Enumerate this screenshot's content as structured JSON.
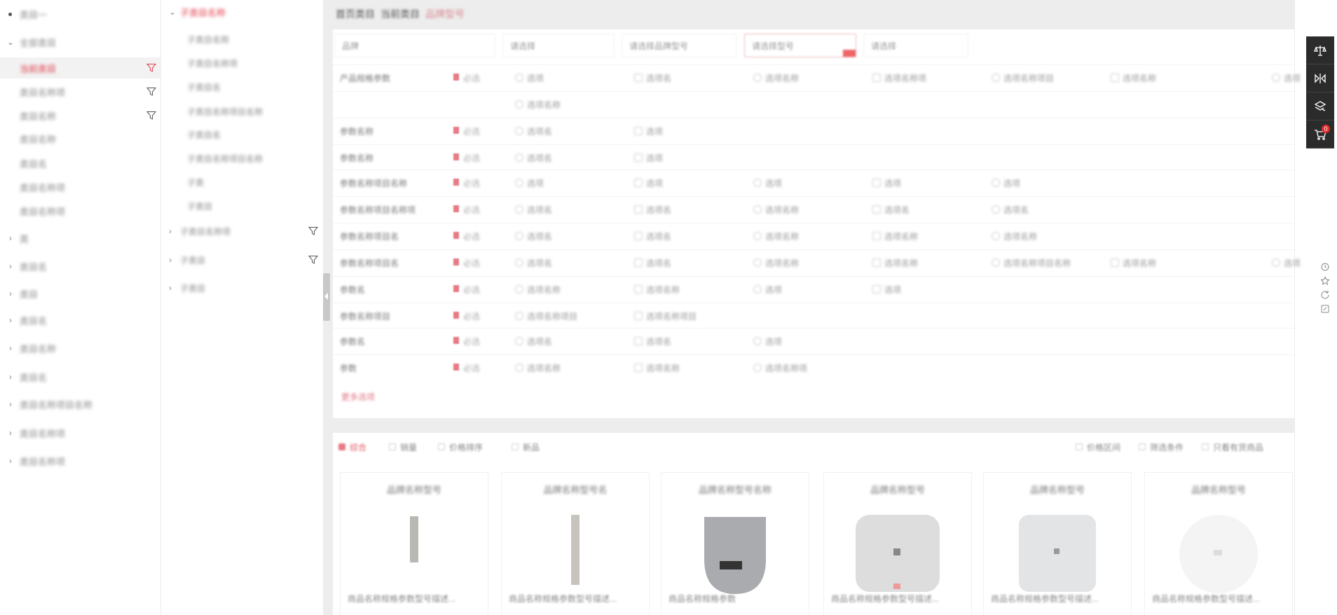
{
  "level1": [
    {
      "label": "类目一",
      "arrow": "dot",
      "filter": false,
      "active": false
    },
    {
      "label": "全部类目",
      "arrow": "down",
      "filter": false,
      "active": false
    },
    {
      "label": "当前类目",
      "arrow": "",
      "filter": true,
      "active": true
    },
    {
      "label": "类目名称项",
      "arrow": "",
      "filter": true,
      "active": false
    },
    {
      "label": "类目名称",
      "arrow": "",
      "filter": true,
      "active": false
    },
    {
      "label": "类目名称",
      "arrow": "",
      "filter": false,
      "active": false
    },
    {
      "label": "类目名",
      "arrow": "",
      "filter": false,
      "active": false
    },
    {
      "label": "类目名称项",
      "arrow": "",
      "filter": false,
      "active": false
    },
    {
      "label": "类目名称项",
      "arrow": "",
      "filter": false,
      "active": false
    },
    {
      "label": "类",
      "arrow": "right",
      "filter": false,
      "active": false
    },
    {
      "label": "类目名",
      "arrow": "right",
      "filter": false,
      "active": false
    },
    {
      "label": "类目",
      "arrow": "right",
      "filter": false,
      "active": false
    },
    {
      "label": "类目名",
      "arrow": "right",
      "filter": false,
      "active": false
    },
    {
      "label": "类目名称",
      "arrow": "right",
      "filter": false,
      "active": false
    },
    {
      "label": "类目名",
      "arrow": "right",
      "filter": false,
      "active": false
    },
    {
      "label": "类目名称项目名称",
      "arrow": "right",
      "filter": false,
      "active": false
    },
    {
      "label": "类目名称项",
      "arrow": "right",
      "filter": false,
      "active": false
    },
    {
      "label": "类目名称项",
      "arrow": "right",
      "filter": false,
      "active": false
    }
  ],
  "level2": [
    {
      "label": "子类目名称",
      "type": "head",
      "filter": false
    },
    {
      "label": "子类目名称",
      "type": "item",
      "filter": false
    },
    {
      "label": "子类目名称项",
      "type": "item",
      "filter": false
    },
    {
      "label": "子类目名",
      "type": "item",
      "filter": false
    },
    {
      "label": "子类目名称项目名称",
      "type": "item",
      "filter": false
    },
    {
      "label": "子类目名",
      "type": "item",
      "filter": false
    },
    {
      "label": "子类目名称项目名称",
      "type": "item",
      "filter": false
    },
    {
      "label": "子类",
      "type": "item",
      "filter": false
    },
    {
      "label": "子类目",
      "type": "item",
      "filter": false
    },
    {
      "label": "子类目名称项",
      "type": "grp",
      "filter": true
    },
    {
      "label": "子类目",
      "type": "grp",
      "filter": true
    },
    {
      "label": "子类目",
      "type": "grp",
      "filter": false
    }
  ],
  "breadcrumb": {
    "a": "首页类目",
    "b": "当前类目",
    "c": "品牌型号"
  },
  "selects": [
    {
      "text": "品牌",
      "hl": false
    },
    {
      "text": "请选择",
      "hl": false
    },
    {
      "text": "请选择品牌型号",
      "hl": false
    },
    {
      "text": "请选择型号",
      "hl": true
    },
    {
      "text": "请选择",
      "hl": false
    }
  ],
  "filters": [
    {
      "name": "产品规格参数",
      "req": "必选",
      "opts": [
        "选项",
        "选项名",
        "选项名称",
        "选项名称项",
        "选项名称项目",
        "选项名称",
        "选项"
      ]
    },
    {
      "name": "",
      "req": "",
      "opts": [
        "选项名称"
      ]
    },
    {
      "name": "参数名称",
      "req": "必选",
      "opts": [
        "选项名",
        "选项"
      ]
    },
    {
      "name": "参数名称",
      "req": "必选",
      "opts": [
        "选项名",
        "选项"
      ]
    },
    {
      "name": "参数名称项目名称",
      "req": "必选",
      "opts": [
        "选项",
        "选项",
        "选项",
        "选项",
        "选项"
      ]
    },
    {
      "name": "参数名称项目名称项",
      "req": "必选",
      "opts": [
        "选项名",
        "选项名",
        "选项名称",
        "选项名",
        "选项名"
      ]
    },
    {
      "name": "参数名称项目名",
      "req": "必选",
      "opts": [
        "选项名",
        "选项名",
        "选项名称",
        "选项名称",
        "选项名称"
      ]
    },
    {
      "name": "参数名称项目名",
      "req": "必选",
      "opts": [
        "选项名",
        "选项名",
        "选项名称",
        "选项名称",
        "选项名称项目名称",
        "选项名称",
        "选项"
      ]
    },
    {
      "name": "参数名",
      "req": "必选",
      "opts": [
        "选项名称",
        "选项名称",
        "选项",
        "选项"
      ]
    },
    {
      "name": "参数名称项目",
      "req": "必选",
      "opts": [
        "选项名称项目",
        "选项名称项目"
      ]
    },
    {
      "name": "参数名",
      "req": "必选",
      "opts": [
        "选项名",
        "选项名",
        "选项"
      ]
    },
    {
      "name": "参数",
      "req": "必选",
      "opts": [
        "选项名称",
        "选项名称",
        "选项名称项"
      ]
    }
  ],
  "more_label": "更多选项",
  "sorts": [
    {
      "label": "综合",
      "active": true
    },
    {
      "label": "销量",
      "active": false
    },
    {
      "label": "价格排序",
      "active": false
    },
    {
      "label": "新品",
      "active": false
    }
  ],
  "sorts_right": [
    "价格区间",
    "筛选条件",
    "只看有货商品"
  ],
  "products": [
    {
      "brand": "品牌名称型号",
      "title": "商品名称规格参数型号描述..."
    },
    {
      "brand": "品牌名称型号名",
      "title": "商品名称规格参数型号描述..."
    },
    {
      "brand": "品牌名称型号名称",
      "title": "商品名称规格参数"
    },
    {
      "brand": "品牌名称型号",
      "title": "商品名称规格参数型号描述..."
    },
    {
      "brand": "品牌名称型号",
      "title": "商品名称规格参数型号描述..."
    },
    {
      "brand": "品牌名称型号",
      "title": "商品名称规格参数型号描述..."
    }
  ],
  "cart_count": "0",
  "colors": {
    "accent": "#e03c4b",
    "toolbar": "#2b2b2b"
  }
}
